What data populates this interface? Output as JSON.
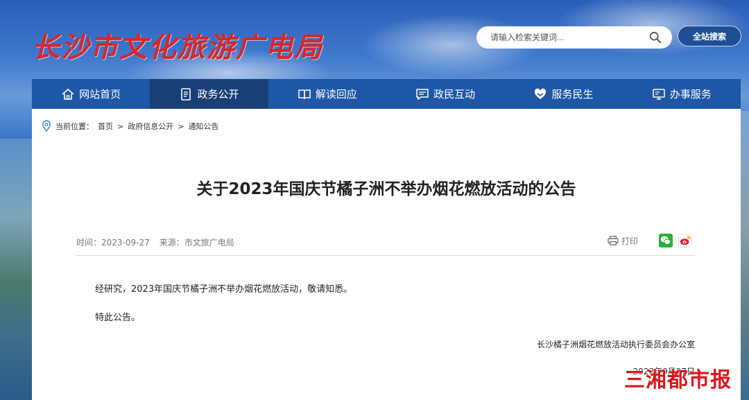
{
  "header": {
    "logo": "长沙市文化旅游广电局",
    "search_placeholder": "请输入检索关键词...",
    "search_button": "全站搜索"
  },
  "nav": [
    {
      "label": "网站首页",
      "icon": "home-icon"
    },
    {
      "label": "政务公开",
      "icon": "document-icon",
      "active": true
    },
    {
      "label": "解读回应",
      "icon": "book-icon"
    },
    {
      "label": "政民互动",
      "icon": "chat-icon"
    },
    {
      "label": "服务民生",
      "icon": "heart-hands-icon"
    },
    {
      "label": "办事服务",
      "icon": "monitor-icon"
    }
  ],
  "breadcrumb": {
    "prefix": "当前位置：",
    "items": [
      "首页",
      "政府信息公开",
      "通知公告"
    ]
  },
  "article": {
    "title": "关于2023年国庆节橘子洲不举办烟花燃放活动的公告",
    "time": "时间：2023-09-27",
    "source": "来源：市文旅广电局",
    "print_label": "打印",
    "paragraphs": [
      "经研究，2023年国庆节橘子洲不举办烟花燃放活动，敬请知悉。",
      "特此公告。"
    ],
    "signature": "长沙橘子洲烟花燃放活动执行委员会办公室",
    "date": "2023年9月27日"
  },
  "watermark": "三湘都市报",
  "colors": {
    "nav_bg": "#1d57a5",
    "nav_active": "#1a3f76",
    "logo_red": "#d8262b",
    "watermark_red": "#d61a1f"
  }
}
